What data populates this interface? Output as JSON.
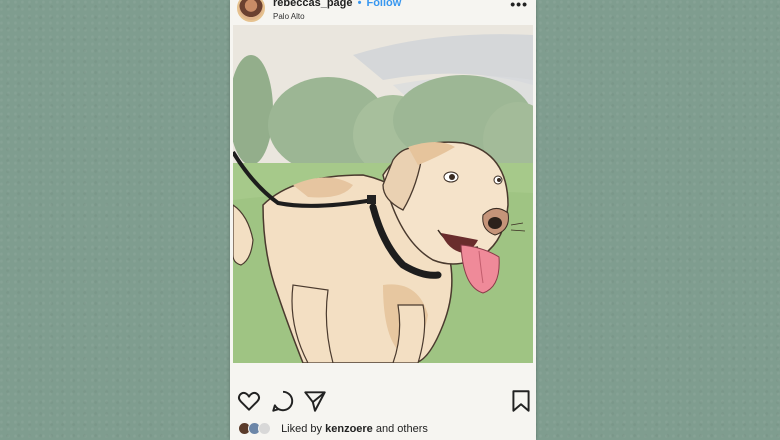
{
  "post": {
    "username": "rebeccas_page",
    "separator": "•",
    "follow_label": "Follow",
    "location": "Palo Alto",
    "more_label": "•••"
  },
  "image": {
    "description_icon": "dog-on-leash-illustration"
  },
  "actions": {
    "like_icon": "heart-icon",
    "comment_icon": "comment-icon",
    "share_icon": "send-icon",
    "save_icon": "bookmark-icon"
  },
  "likes": {
    "prefix": "Liked by",
    "user": "kenzoere",
    "suffix": "and others"
  },
  "colors": {
    "background": "#7f9d8f",
    "card": "#f6f5f1",
    "accent": "#3897f0"
  }
}
